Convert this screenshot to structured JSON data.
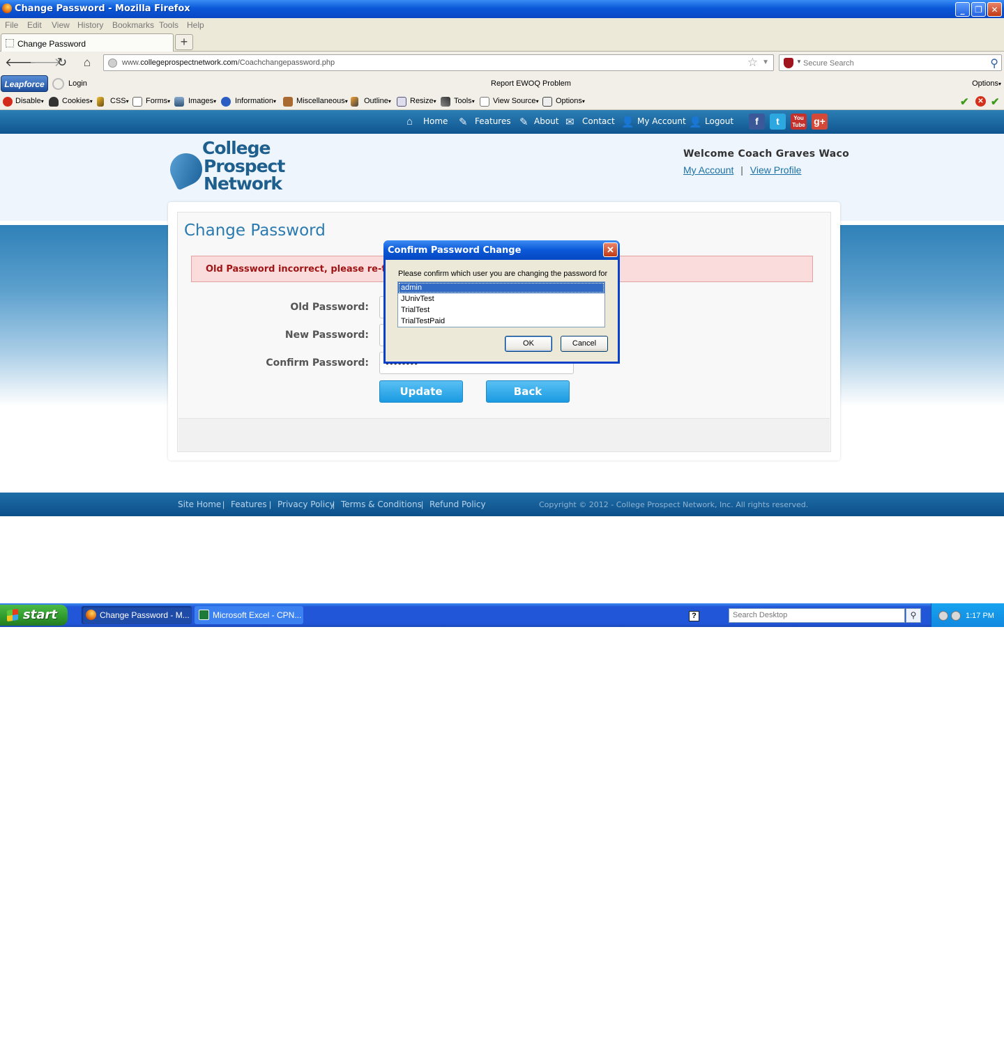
{
  "window": {
    "title": "Change Password - Mozilla Firefox"
  },
  "menu": [
    "File",
    "Edit",
    "View",
    "History",
    "Bookmarks",
    "Tools",
    "Help"
  ],
  "tab": {
    "label": "Change Password",
    "new_tab": "+"
  },
  "address": {
    "url_prefix": "www.",
    "url_domain": "collegeprospectnetwork.com",
    "url_path": "/Coachchangepassword.php",
    "search_placeholder": "Secure Search"
  },
  "leapforce": {
    "brand": "Leapforce",
    "login": "Login",
    "report": "Report EWOQ Problem",
    "options": "Options"
  },
  "devtools": [
    "Disable",
    "Cookies",
    "CSS",
    "Forms",
    "Images",
    "Information",
    "Miscellaneous",
    "Outline",
    "Resize",
    "Tools",
    "View Source",
    "Options"
  ],
  "site_nav": [
    "Home",
    "Features",
    "About",
    "Contact",
    "My Account",
    "Logout"
  ],
  "logo": {
    "line1": "College",
    "line2": "Prospect",
    "line3": "Network"
  },
  "header": {
    "welcome": "Welcome Coach Graves Waco",
    "my_account": "My Account",
    "separator": "|",
    "view_profile": "View Profile"
  },
  "main": {
    "title": "Change Password",
    "error": "Old Password incorrect, please re-try",
    "old_label": "Old Password:",
    "new_label": "New Password:",
    "confirm_label": "Confirm Password:",
    "confirm_value": "••••••••",
    "update": "Update",
    "back": "Back"
  },
  "footer": {
    "links": [
      "Site Home",
      "Features",
      "Privacy Policy",
      "Terms & Conditions",
      "Refund Policy"
    ],
    "copyright": "Copyright © 2012 - College Prospect Network, Inc. All rights reserved."
  },
  "dialog": {
    "title": "Confirm Password Change",
    "prompt": "Please confirm which user you are changing the password for",
    "users": [
      "admin",
      "JUnivTest",
      "TrialTest",
      "TrialTestPaid"
    ],
    "selected": "admin",
    "ok": "OK",
    "cancel": "Cancel"
  },
  "taskbar": {
    "start": "start",
    "tasks": [
      "Change Password - M...",
      "Microsoft Excel - CPN..."
    ],
    "search_placeholder": "Search Desktop",
    "clock": "1:17 PM"
  },
  "colors": {
    "site_blue": "#1f6ea8",
    "title_blue": "#2a7ab0",
    "error_text": "#9e1414",
    "button_blue": "#1a9ae2",
    "xp_blue": "#0a58d8"
  }
}
